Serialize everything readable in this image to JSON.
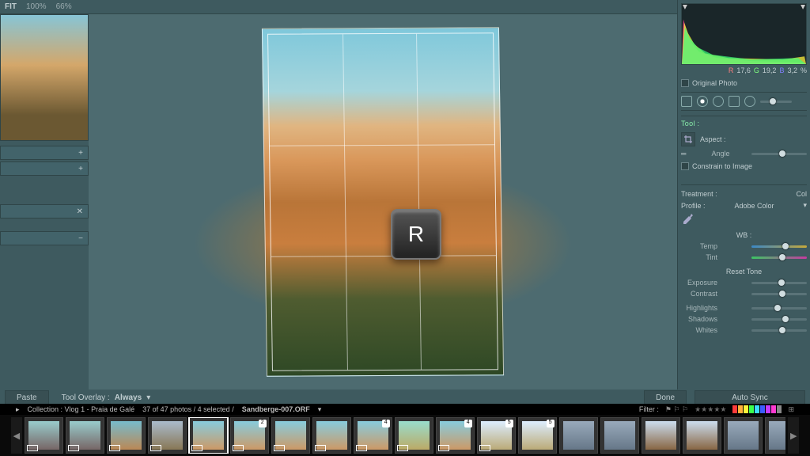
{
  "toolbar": {
    "fit": "FIT",
    "zoom100": "100%",
    "zoom66": "66%"
  },
  "keycap": "R",
  "left_buttons": [
    "+",
    "+",
    "✕",
    "−"
  ],
  "bottom": {
    "paste": "Paste",
    "overlay_label": "Tool Overlay :",
    "overlay_value": "Always",
    "done": "Done",
    "auto_sync": "Auto Sync"
  },
  "status": {
    "collection": "Collection : Vlog 1 - Praia de Galé",
    "count": "37 of 47 photos / 4 selected /",
    "filename": "Sandberge-007.ORF",
    "filter_label": "Filter :"
  },
  "histo": {
    "R": "R",
    "Rv": "17,6",
    "G": "G",
    "Gv": "19,2",
    "B": "B",
    "Bv": "3,2",
    "pct": "%"
  },
  "panel": {
    "orig": "Original Photo",
    "tool": "Tool :",
    "aspect": "Aspect :",
    "angle": "Angle",
    "constrain": "Constrain to Image",
    "treatment": "Treatment :",
    "treat_val": "Col",
    "profile": "Profile :",
    "profile_val": "Adobe Color",
    "wb": "WB :",
    "temp": "Temp",
    "tint": "Tint",
    "reset_tone": "Reset Tone",
    "exposure": "Exposure",
    "contrast": "Contrast",
    "highlights": "Highlights",
    "shadows": "Shadows",
    "whites": "Whites"
  },
  "filmstrip_badges": [
    "",
    "",
    "",
    "",
    "",
    "2",
    "",
    "",
    "4",
    "",
    "4",
    "5",
    "5",
    "",
    "",
    "",
    "",
    "",
    ""
  ],
  "swatch_colors": [
    "#ff3b3b",
    "#ffb03b",
    "#fff23b",
    "#3bff4c",
    "#3bdcff",
    "#3b5cff",
    "#c43bff",
    "#ff3bd1",
    "#888"
  ]
}
